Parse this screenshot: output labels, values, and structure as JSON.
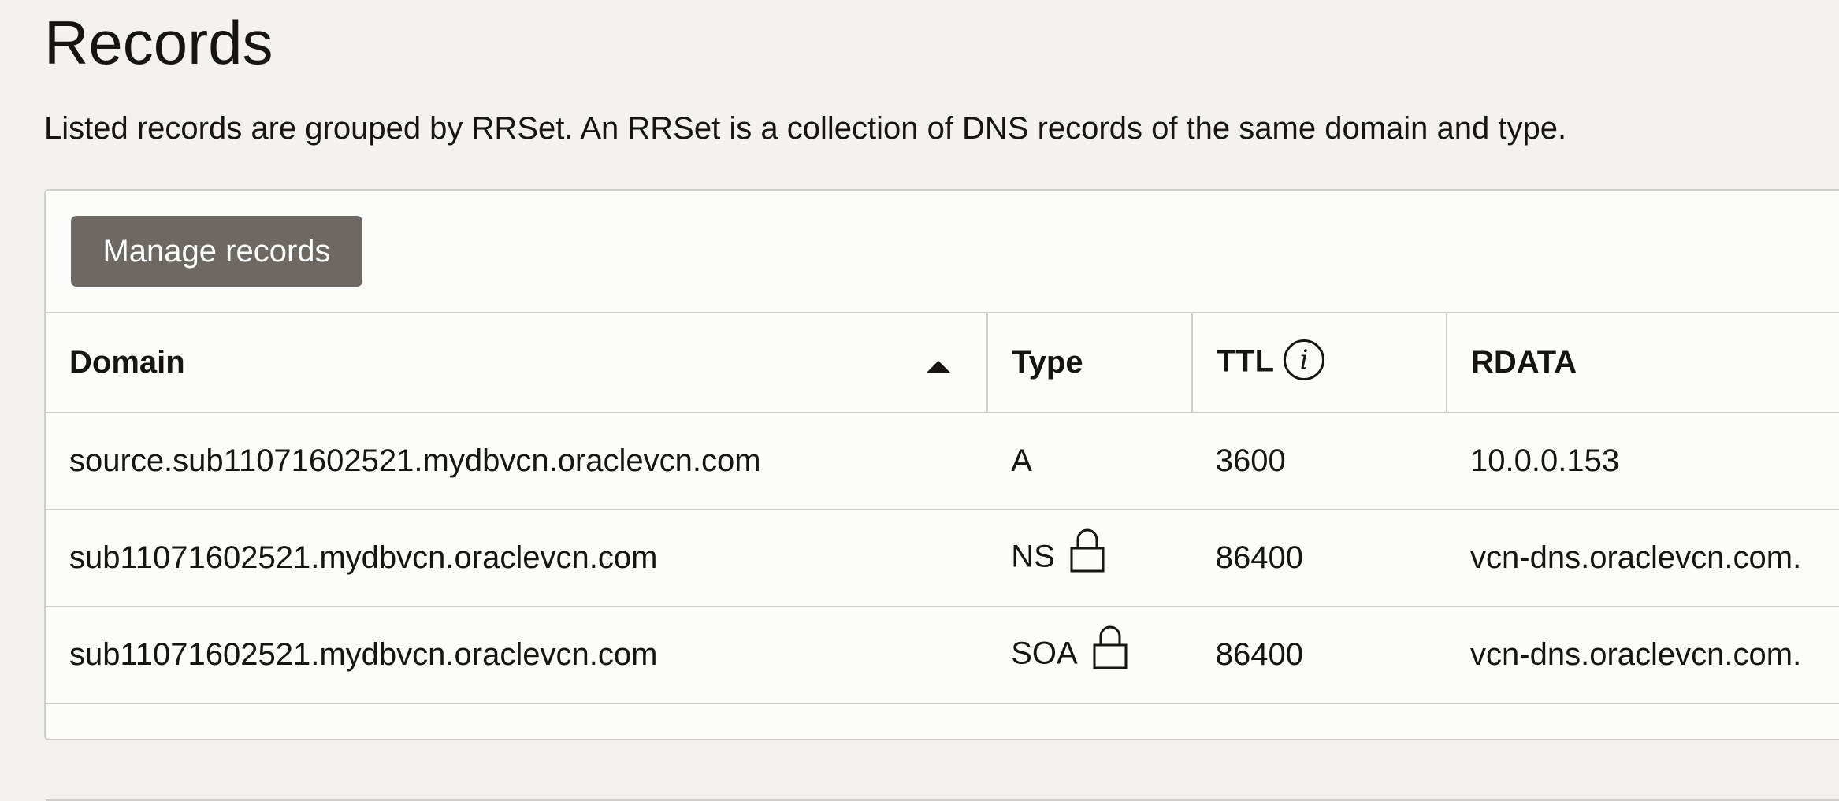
{
  "page": {
    "title": "Records",
    "description": "Listed records are grouped by RRSet. An RRSet is a collection of DNS records of the same domain and type."
  },
  "toolbar": {
    "manage_label": "Manage records"
  },
  "table": {
    "columns": {
      "domain": "Domain",
      "type": "Type",
      "ttl": "TTL",
      "rdata": "RDATA"
    },
    "sort": {
      "column": "domain",
      "direction": "ascending",
      "icon": "sort-ascending-icon"
    },
    "ttl_info_icon": "info-icon",
    "rows": [
      {
        "domain": "source.sub11071602521.mydbvcn.oraclevcn.com",
        "type": "A",
        "locked": false,
        "ttl": "3600",
        "rdata": "10.0.0.153"
      },
      {
        "domain": "sub11071602521.mydbvcn.oraclevcn.com",
        "type": "NS",
        "locked": true,
        "ttl": "86400",
        "rdata": "vcn-dns.oraclevcn.com."
      },
      {
        "domain": "sub11071602521.mydbvcn.oraclevcn.com",
        "type": "SOA",
        "locked": true,
        "ttl": "86400",
        "rdata": "vcn-dns.oraclevcn.com."
      }
    ]
  },
  "colors": {
    "page_background": "#f3f2f0",
    "panel_background": "#fcfcfb",
    "button_background": "#6d6863",
    "button_text": "#ffffff",
    "text": "#161513",
    "border": "#cfcdca"
  }
}
